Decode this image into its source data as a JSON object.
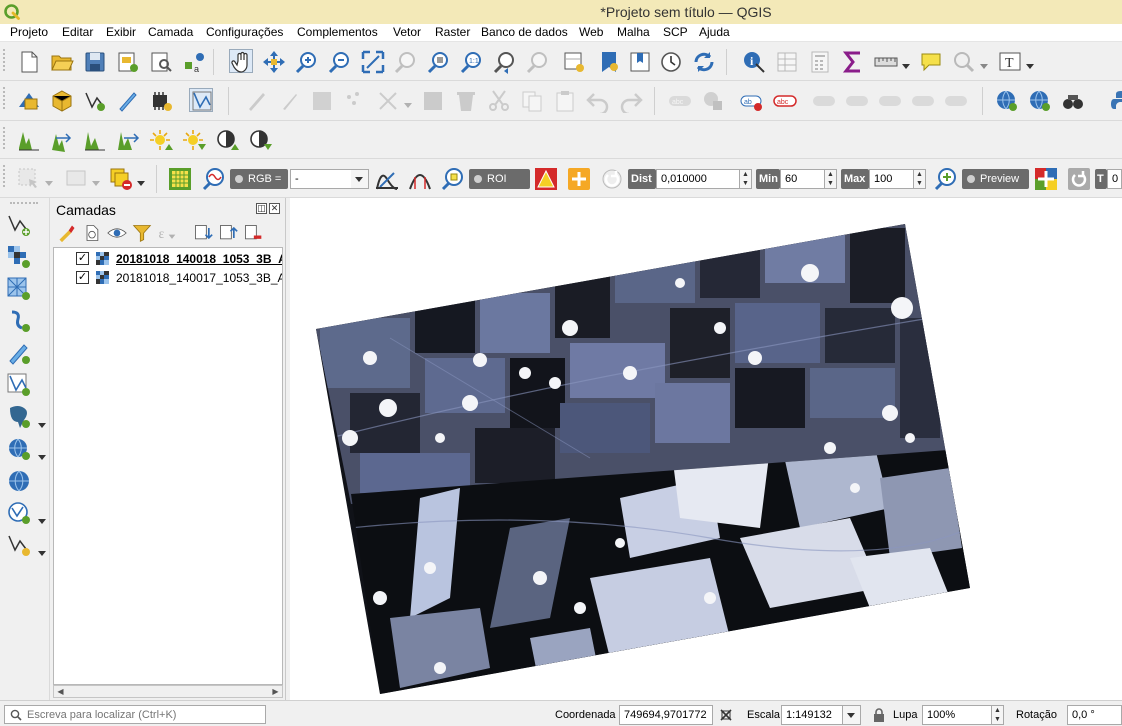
{
  "window": {
    "title": "*Projeto sem título — QGIS"
  },
  "menu": [
    "Projeto",
    "Editar",
    "Exibir",
    "Camada",
    "Configurações",
    "Complementos",
    "Vetor",
    "Raster",
    "Banco de dados",
    "Web",
    "Malha",
    "SCP",
    "Ajuda"
  ],
  "scp_toolbar": {
    "rgb_label": "RGB =",
    "rgb_value": "-",
    "roi_label": "ROI",
    "dist_label": "Dist",
    "dist_value": "0,010000",
    "min_label": "Min",
    "min_value": "60",
    "max_label": "Max",
    "max_value": "100",
    "preview_label": "Preview",
    "t_label": "T",
    "t_value": "0"
  },
  "layers_panel": {
    "title": "Camadas",
    "layers": [
      {
        "name": "20181018_140018_1053_3B_A",
        "checked": true,
        "selected": true
      },
      {
        "name": "20181018_140017_1053_3B_A",
        "checked": true,
        "selected": false
      }
    ]
  },
  "status": {
    "locator_placeholder": "Escreva para localizar (Ctrl+K)",
    "coord_label": "Coordenada",
    "coord_value": "749694,9701772",
    "scale_label": "Escala",
    "scale_value": "1:149132",
    "magnifier_label": "Lupa",
    "magnifier_value": "100%",
    "rotation_label": "Rotação",
    "rotation_value": "0,0 °"
  },
  "colors": {
    "titlebar": "#f3e9b8",
    "accent_green": "#5a9e2a",
    "accent_blue": "#2f6db5",
    "sigma_purple": "#8a1d8a"
  }
}
